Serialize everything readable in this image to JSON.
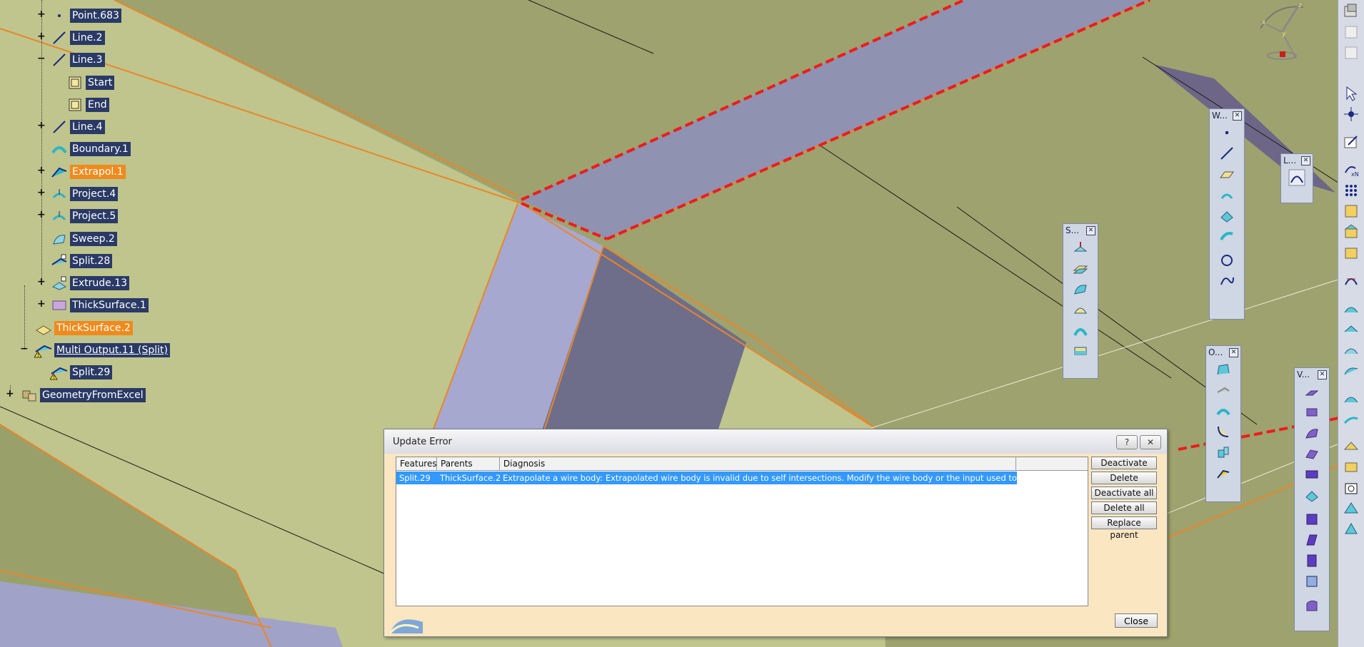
{
  "spec_tree": {
    "nodes": [
      {
        "label": "Point.683",
        "icon": "point-icon",
        "style": "selected"
      },
      {
        "label": "Line.2",
        "icon": "line-icon",
        "style": "selected"
      },
      {
        "label": "Line.3",
        "icon": "line-icon",
        "style": "selected"
      },
      {
        "label": "Start",
        "icon": "parameter-icon",
        "style": "selected"
      },
      {
        "label": "End",
        "icon": "parameter-icon",
        "style": "selected"
      },
      {
        "label": "Line.4",
        "icon": "line-icon",
        "style": "selected"
      },
      {
        "label": "Boundary.1",
        "icon": "boundary-icon",
        "style": "selected"
      },
      {
        "label": "Extrapol.1",
        "icon": "extrapolate-icon",
        "style": "highlight"
      },
      {
        "label": "Project.4",
        "icon": "project-icon",
        "style": "selected"
      },
      {
        "label": "Project.5",
        "icon": "project-icon",
        "style": "selected"
      },
      {
        "label": "Sweep.2",
        "icon": "sweep-icon",
        "style": "selected"
      },
      {
        "label": "Split.28",
        "icon": "split-icon",
        "style": "selected"
      },
      {
        "label": "Extrude.13",
        "icon": "extrude-icon",
        "style": "selected"
      },
      {
        "label": "ThickSurface.1",
        "icon": "thicksurface-icon",
        "style": "selected"
      },
      {
        "label": "ThickSurface.2",
        "icon": "thicksurface-icon",
        "style": "highlight"
      },
      {
        "label": "Multi Output.11 (Split)",
        "icon": "multi-output-icon",
        "style": "selected-underline"
      },
      {
        "label": "Split.29",
        "icon": "split-warning-icon",
        "style": "selected"
      },
      {
        "label": "GeometryFromExcel",
        "icon": "geometry-set-icon",
        "style": "selected"
      }
    ]
  },
  "toolbars": {
    "wireframe": {
      "title": "W..."
    },
    "law": {
      "title": "L..."
    },
    "surfaces": {
      "title": "S..."
    },
    "operations": {
      "title": "O..."
    },
    "volumes": {
      "title": "V..."
    }
  },
  "dialog": {
    "title": "Update Error",
    "help_label": "?",
    "close_x_label": "✕",
    "columns": [
      "Features",
      "Parents",
      "Diagnosis"
    ],
    "rows": [
      {
        "feature": "Split.29",
        "parent": "ThickSurface.2",
        "diagnosis": "Extrapolate a wire body: Extrapolated wire body is invalid due to self intersections. Modify the wire body or the input used to generate it."
      }
    ],
    "buttons": {
      "deactivate": "Deactivate",
      "delete": "Delete",
      "deactivate_all": "Deactivate all",
      "delete_all": "Delete all",
      "replace_parent": "Replace parent",
      "close": "Close"
    }
  },
  "colors": {
    "tree_label_bg": "#2a3a66",
    "tree_highlight_bg": "#f08a1c",
    "surface_olive": "#9ea26e",
    "surface_light": "#bfc58c",
    "surface_lavender": "#9c9dc4",
    "edge_orange": "#e8862a",
    "edge_red_dashed": "#ee1c1c",
    "dialog_bg": "#fbe6c2",
    "selection_blue": "#3399ff"
  }
}
